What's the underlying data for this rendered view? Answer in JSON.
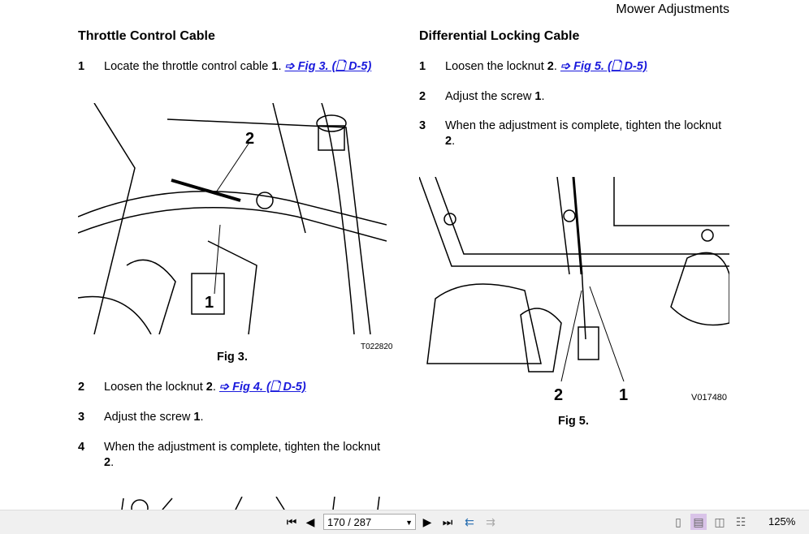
{
  "header": {
    "title": "Mower Adjustments"
  },
  "left": {
    "heading": "Throttle Control Cable",
    "steps": [
      {
        "num": "1",
        "text": "Locate the throttle control cable ",
        "bold": "1",
        "link": "➩ Fig 3. (🗋 D-5)"
      },
      {
        "num": "2",
        "text": "Loosen the locknut ",
        "bold": "2",
        "link": "➩ Fig 4. (🗋 D-5)"
      },
      {
        "num": "3",
        "text": "Adjust the screw ",
        "bold": "1",
        "end": "."
      },
      {
        "num": "4",
        "text": "When the adjustment is complete, tighten the locknut ",
        "bold": "2",
        "end": "."
      }
    ],
    "figure": {
      "caption": "Fig 3.",
      "code": "T022820",
      "callout1": "1",
      "callout2": "2"
    }
  },
  "right": {
    "heading": "Differential Locking Cable",
    "steps": [
      {
        "num": "1",
        "text": "Loosen the locknut ",
        "bold": "2",
        "link": "➩ Fig 5. (🗋 D-5)"
      },
      {
        "num": "2",
        "text": "Adjust the screw ",
        "bold": "1",
        "end": "."
      },
      {
        "num": "3",
        "text": "When the adjustment is complete, tighten the locknut ",
        "bold": "2",
        "end": "."
      }
    ],
    "figure": {
      "caption": "Fig 5.",
      "code": "V017480",
      "callout1": "1",
      "callout2": "2"
    }
  },
  "toolbar": {
    "page": "170 / 287",
    "zoom": "125%",
    "active_view": "single-continuous"
  }
}
